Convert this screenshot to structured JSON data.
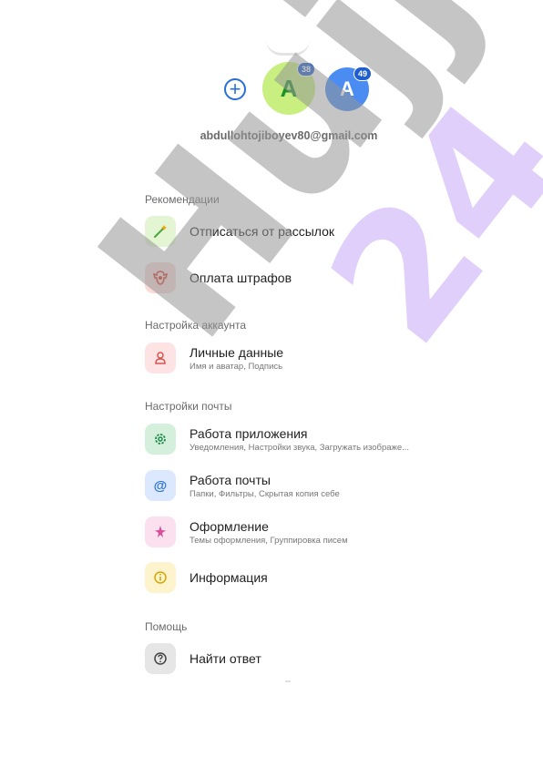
{
  "account": {
    "add_symbol": "+",
    "main_avatar_letter": "A",
    "main_badge": "38",
    "second_avatar_letter": "A",
    "second_badge": "49",
    "email": "abdullohtojiboyev80@gmail.com"
  },
  "sections": {
    "recommendations": "Рекомендации",
    "account_settings": "Настройка аккаунта",
    "mail_settings": "Настройки почты",
    "help": "Помощь"
  },
  "items": {
    "unsubscribe": {
      "title": "Отписаться от рассылок",
      "icon": "magic-wand-icon",
      "bg": "#e4f5d3"
    },
    "fines": {
      "title": "Оплата штрафов",
      "icon": "emblem-icon",
      "bg": "#fbdada"
    },
    "personal": {
      "title": "Личные данные",
      "subtitle": "Имя и аватар, Подпись",
      "icon": "person-icon",
      "bg": "#fde3e3"
    },
    "app": {
      "title": "Работа приложения",
      "subtitle": "Уведомления, Настройки звука, Загружать изображе...",
      "icon": "gear-icon",
      "bg": "#d4f0dc"
    },
    "mail": {
      "title": "Работа почты",
      "subtitle": "Папки, Фильтры, Скрытая копия себе",
      "icon": "at-icon",
      "bg": "#dce8fd"
    },
    "design": {
      "title": "Оформление",
      "subtitle": "Темы оформления, Группировка писем",
      "icon": "sparkle-icon",
      "bg": "#fbe1ef"
    },
    "info": {
      "title": "Информация",
      "icon": "info-icon",
      "bg": "#fdf3cd"
    },
    "find_answer": {
      "title": "Найти ответ",
      "icon": "question-icon",
      "bg": "#e6e6e6"
    }
  },
  "watermark": {
    "left": "Hujjat",
    "right": "24"
  },
  "colors": {
    "accent": "#2a6fd6",
    "main_avatar": "#c8ef7f",
    "second_avatar": "#4a8cf1"
  }
}
